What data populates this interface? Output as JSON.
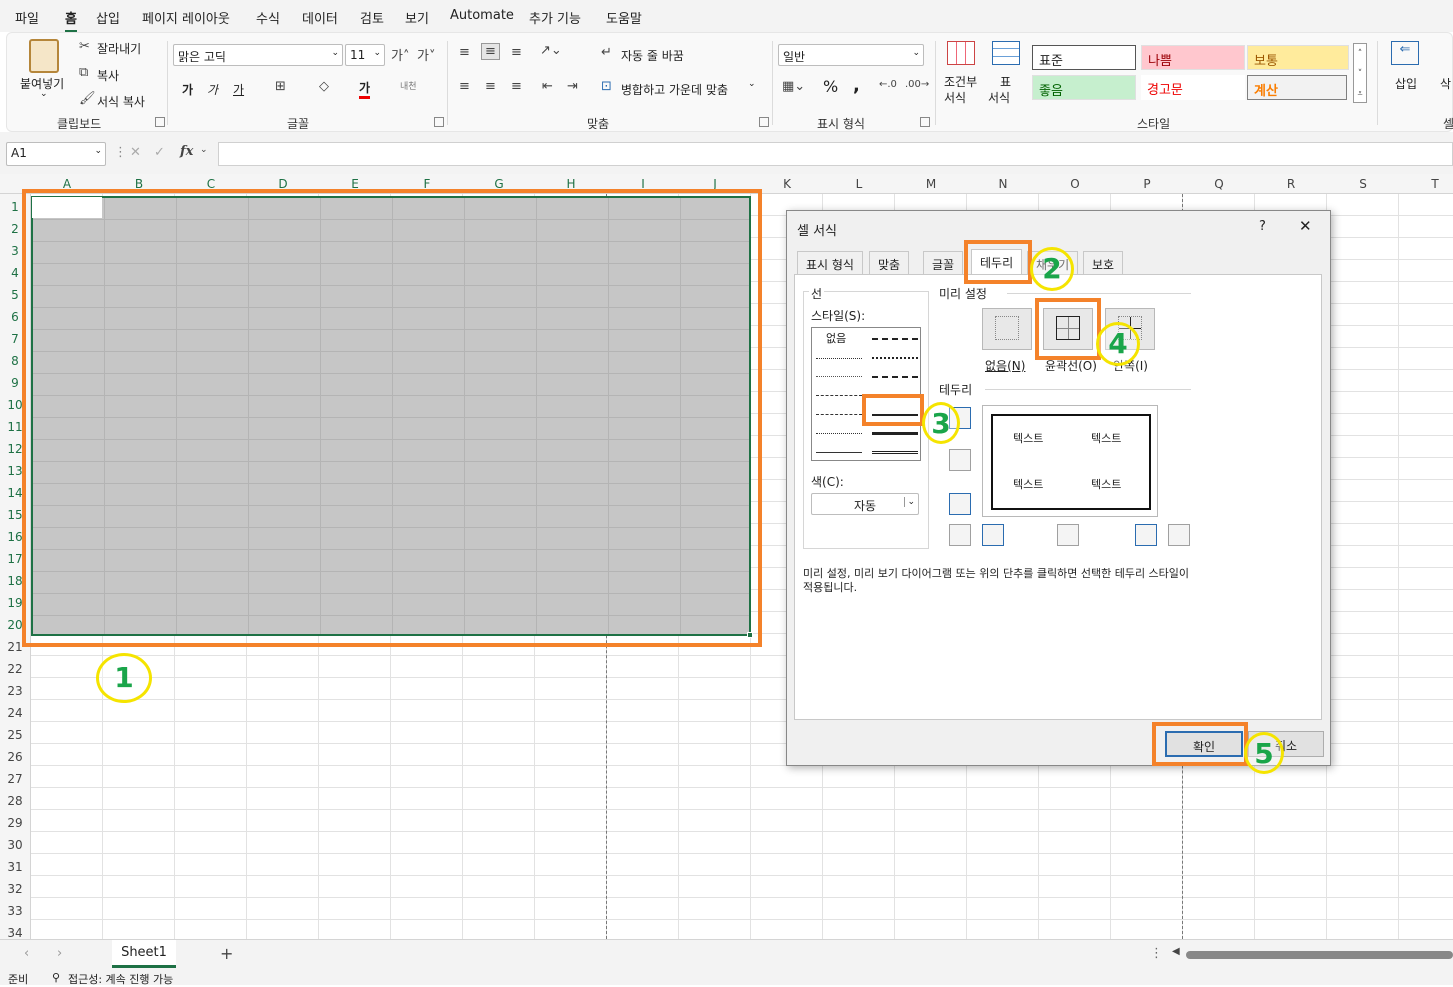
{
  "menu": [
    "파일",
    "홈",
    "삽입",
    "페이지 레이아웃",
    "수식",
    "데이터",
    "검토",
    "보기",
    "Automate",
    "추가 기능",
    "도움말"
  ],
  "ribbon": {
    "clipboard": {
      "paste": "붙여넣기",
      "cut": "잘라내기",
      "copy": "복사",
      "format_painter": "서식 복사",
      "label": "클립보드"
    },
    "font": {
      "name": "맑은 고딕",
      "size": "11",
      "label": "글꼴",
      "bold": "가",
      "italic": "가",
      "underline": "가",
      "fontcolor_glyph": "가",
      "phonetic": "내천"
    },
    "align": {
      "wrap": "자동 줄 바꿈",
      "merge": "병합하고 가운데 맞춤",
      "label": "맞춤"
    },
    "number": {
      "format": "일반",
      "percent": "%",
      "comma": ",",
      "label": "표시 형식"
    },
    "styles": {
      "cond": "조건부",
      "cond2": "서식",
      "table": "표",
      "table2": "서식",
      "normal": "표준",
      "bad": "나쁨",
      "neutral": "보통",
      "good": "좋음",
      "warning": "경고문",
      "calc": "계산",
      "label": "스타일"
    },
    "cells": {
      "insert": "삽입",
      "delete": "삭"
    }
  },
  "formula": {
    "namebox": "A1",
    "fx": "fx",
    "value": ""
  },
  "columns": [
    "A",
    "B",
    "C",
    "D",
    "E",
    "F",
    "G",
    "H",
    "I",
    "J",
    "K",
    "L",
    "M",
    "N",
    "O",
    "P",
    "Q",
    "R",
    "S",
    "T"
  ],
  "rows": [
    "1",
    "2",
    "3",
    "4",
    "5",
    "6",
    "7",
    "8",
    "9",
    "10",
    "11",
    "12",
    "13",
    "14",
    "15",
    "16",
    "17",
    "18",
    "19",
    "20",
    "21",
    "22",
    "23",
    "24",
    "25",
    "26",
    "27",
    "28",
    "29",
    "30",
    "31",
    "32",
    "33",
    "34"
  ],
  "sheet_tab": "Sheet1",
  "add_sheet": "+",
  "status": {
    "ready": "준비",
    "accessibility": "접근성: 계속 진행 가능"
  },
  "dialog": {
    "title": "셀 서식",
    "help": "?",
    "close": "✕",
    "tabs": [
      "표시 형식",
      "맞춤",
      "글꼴",
      "테두리",
      "채우기",
      "보호"
    ],
    "line_group": "선",
    "style_label": "스타일(S):",
    "none": "없음",
    "color_label": "색(C):",
    "color_value": "자동",
    "presets_label": "미리 설정",
    "preset_none": "없음(N)",
    "preset_outline": "윤곽선(O)",
    "preset_inside": "안쪽(I)",
    "border_label": "테두리",
    "preview_text": [
      "텍스트",
      "텍스트",
      "텍스트",
      "텍스트"
    ],
    "hint": "미리 설정, 미리 보기 다이어그램 또는 위의 단추를 클릭하면 선택한 테두리 스타일이\n적용됩니다.",
    "ok": "확인",
    "cancel": "취소"
  },
  "callouts": [
    "1",
    "2",
    "3",
    "4",
    "5"
  ],
  "colors": {
    "accent": "#1e7145",
    "callout_box": "#f4822a",
    "callout_circle": "#f5e400",
    "callout_num": "#1aa54a"
  }
}
